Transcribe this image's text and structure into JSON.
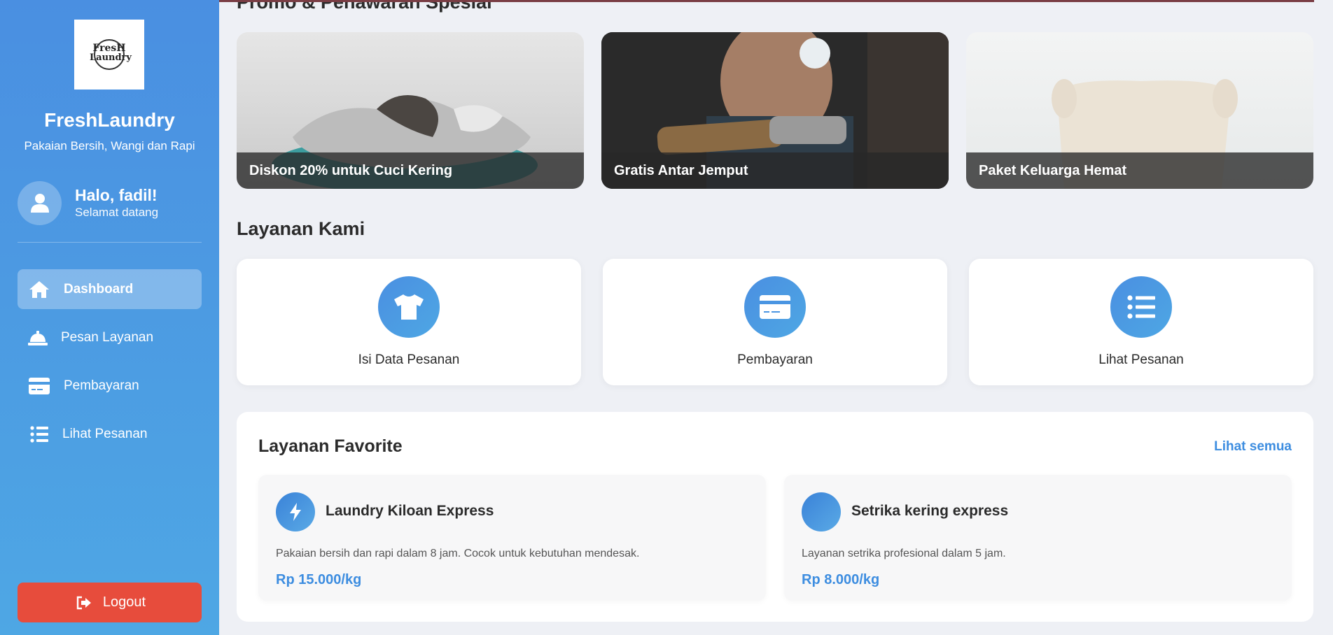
{
  "sidebar": {
    "logo": {
      "line1": "FresH",
      "line2": "Laundry"
    },
    "brand_name": "FreshLaundry",
    "tagline": "Pakaian Bersih, Wangi dan Rapi",
    "user": {
      "greeting": "Halo, fadil!",
      "subtitle": "Selamat datang"
    },
    "nav": [
      {
        "label": "Dashboard",
        "icon": "home-icon",
        "active": true
      },
      {
        "label": "Pesan Layanan",
        "icon": "bell-service-icon",
        "active": false
      },
      {
        "label": "Pembayaran",
        "icon": "credit-card-icon",
        "active": false
      },
      {
        "label": "Lihat Pesanan",
        "icon": "list-icon",
        "active": false
      }
    ],
    "logout_label": "Logout"
  },
  "promo": {
    "title": "Promo & Penawaran Spesial",
    "cards": [
      {
        "caption": "Diskon 20% untuk Cuci Kering"
      },
      {
        "caption": "Gratis Antar Jemput"
      },
      {
        "caption": "Paket Keluarga Hemat"
      }
    ]
  },
  "services": {
    "title": "Layanan Kami",
    "items": [
      {
        "label": "Isi Data Pesanan",
        "icon": "tshirt-icon"
      },
      {
        "label": "Pembayaran",
        "icon": "credit-card-icon"
      },
      {
        "label": "Lihat Pesanan",
        "icon": "list-icon"
      }
    ]
  },
  "favorites": {
    "title": "Layanan Favorite",
    "see_all": "Lihat semua",
    "items": [
      {
        "name": "Laundry Kiloan Express",
        "desc": "Pakaian bersih dan rapi dalam 8 jam. Cocok untuk kebutuhan mendesak.",
        "price": "Rp 15.000/kg",
        "icon": "lightning-icon"
      },
      {
        "name": "Setrika kering express",
        "desc": "Layanan setrika profesional dalam 5 jam.",
        "price": "Rp 8.000/kg",
        "icon": ""
      }
    ]
  },
  "colors": {
    "primary": "#4a8fe1",
    "accent": "#3d8de0",
    "logout": "#e74c3c"
  }
}
